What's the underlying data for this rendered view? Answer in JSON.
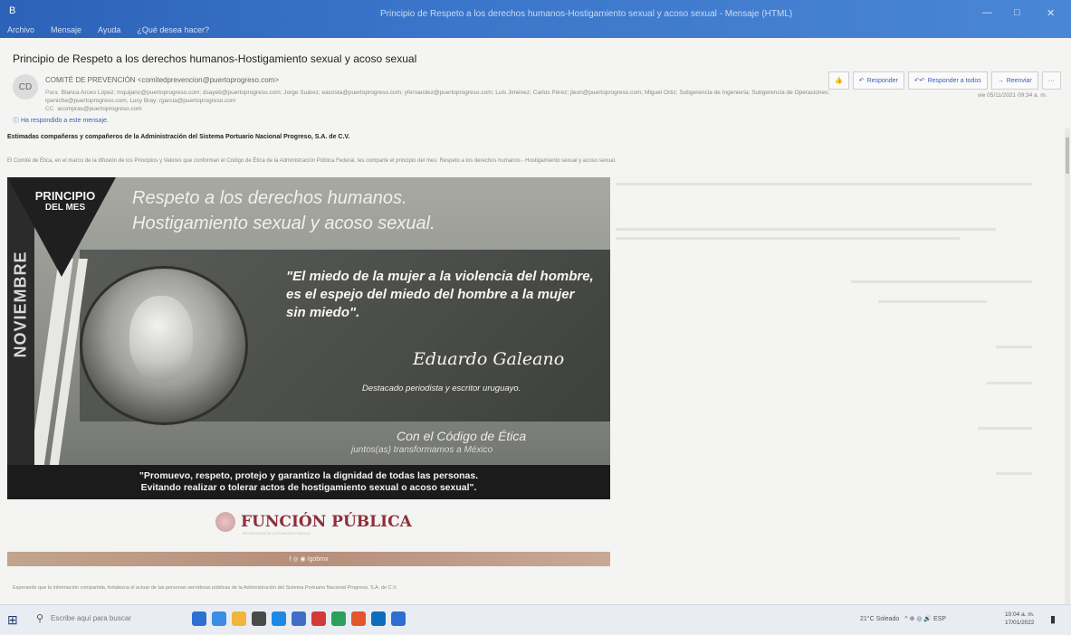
{
  "window": {
    "app_name": "B",
    "title": "Principio de Respeto a los derechos humanos-Hostigamiento sexual y acoso sexual - Mensaje (HTML)",
    "ribbon": [
      "Archivo",
      "Mensaje",
      "Ayuda",
      "¿Qué desea hacer?"
    ],
    "minimize": "—",
    "maximize": "□",
    "close": "✕"
  },
  "email": {
    "subject": "Principio de Respeto a los derechos humanos-Hostigamiento sexual y acoso sexual",
    "avatar": "CD",
    "sender": "COMITÉ DE PREVENCIÓN <comitedprevencion@puertoprogreso.com>",
    "to_label": "Para",
    "recipients": "Blanca Arceo López; mquijano@puertoprogreso.com; dsayeb@puertoprogreso.com; Jorge Suárez; eacosta@puertoprogreso.com; yfernandez@puertoprogreso.com; Luis Jiménez; Carlos Pérez; jleon@puertoprogreso.com; Miguel Ortiz; Subgerencia de Ingeniería; Subgerencia de Operaciones; rpeniche@puertoprogreso.com; Lucy Bray; rgarcia@puertoprogreso.com",
    "cc_label": "CC",
    "cc": "acompras@puertoprogreso.com",
    "date": "vie 05/11/2021 09:34 a. m.",
    "info_notice": "Ha respondido a este mensaje.",
    "greeting": "Estimadas compañeras y compañeros de la Administración del Sistema Portuario Nacional Progreso, S.A. de C.V.",
    "intro": "El Comité de Ética, en el marco de la difusión de los Principios y Valores que conforman el Código de Ética de la Administración Pública Federal, les comparte el principio del mes: Respeto a los derechos humanos - Hostigamiento sexual y acoso sexual.",
    "footer": "Esperando que la información compartida, fortalezca el actuar de las personas servidoras públicas de la Administración del Sistema Portuario Nacional Progreso, S.A. de C.V."
  },
  "actions": {
    "like": "👍",
    "reply": "Responder",
    "reply_all": "Responder a todos",
    "forward": "Reenviar",
    "more": "···"
  },
  "banner": {
    "principle_line1": "PRINCIPIO",
    "principle_line2": "DEL MES",
    "month": "NOVIEMBRE",
    "heading_line1": "Respeto a los derechos humanos.",
    "heading_line2": "Hostigamiento sexual y acoso sexual.",
    "quote": "\"El miedo de la mujer a la violencia del hombre, es el espejo del miedo del hombre a la mujer sin miedo\".",
    "author": "Eduardo Galeano",
    "author_desc": "Destacado periodista y escritor uruguayo.",
    "ethics_line1": "Con el Código de Ética",
    "ethics_line2": "juntos(as) transformamos a México",
    "bottom_line1": "\"Promuevo, respeto, protejo y garantizo la dignidad de todas las personas.",
    "bottom_line2": "Evitando realizar o tolerar actos de hostigamiento sexual o acoso sexual\"."
  },
  "footer_logo": {
    "text": "FUNCIÓN PÚBLICA",
    "sub": "SECRETARÍA DE LA FUNCIÓN PÚBLICA"
  },
  "social_bar": "f ◎ ◉ /gobmx",
  "taskbar": {
    "start_icon": "windows-icon",
    "search_placeholder": "Escribe aquí para buscar",
    "weather": "21°C Soleado",
    "tray_icons": "^ ⊕ ◎ 🔊 ESP",
    "time": "10:04 a. m.",
    "date": "17/01/2022",
    "notification_icon": "▮",
    "app_colors": [
      "#2e6fd3",
      "#3a8ee6",
      "#f3b43c",
      "#4a4a4a",
      "#1e88e5",
      "#3e6ec7",
      "#d33a3a",
      "#2aa05a",
      "#e3552a",
      "#0f6cbd",
      "#2f6ed1"
    ]
  }
}
